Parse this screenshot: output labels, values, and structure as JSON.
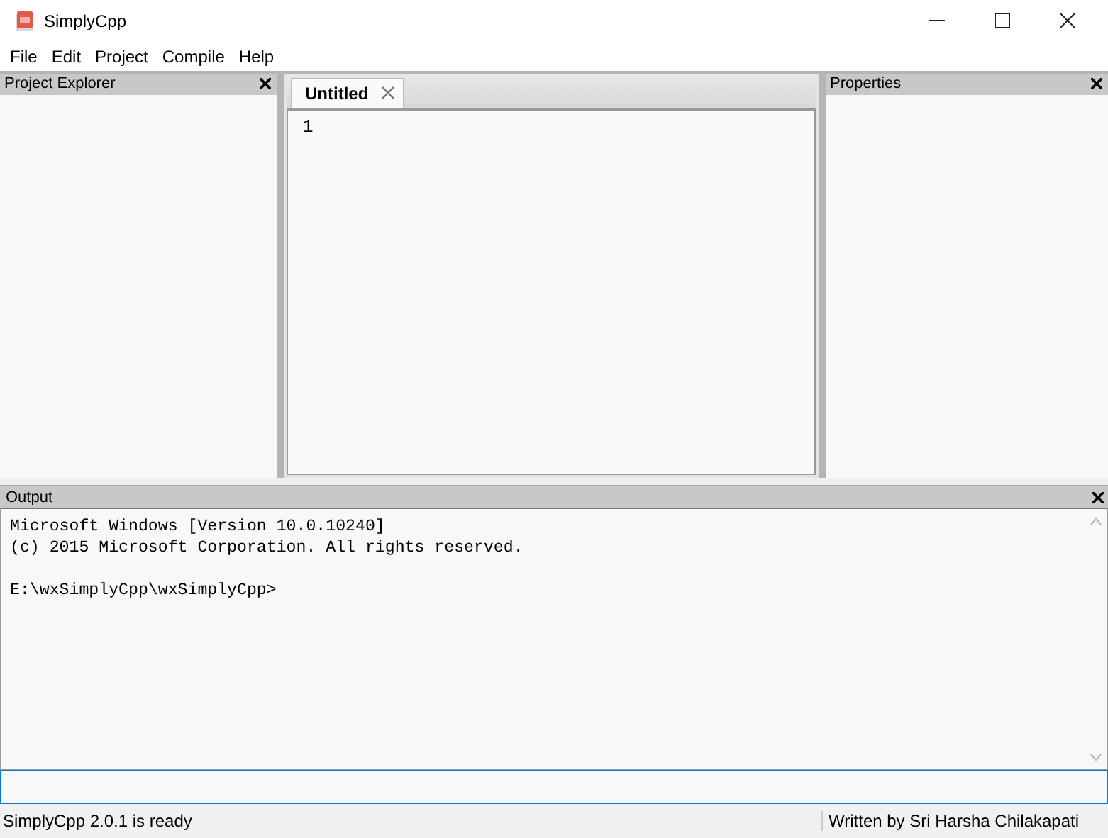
{
  "window": {
    "title": "SimplyCpp"
  },
  "menu": [
    "File",
    "Edit",
    "Project",
    "Compile",
    "Help"
  ],
  "project_explorer": {
    "title": "Project Explorer"
  },
  "editor": {
    "tabs": [
      {
        "label": "Untitled",
        "selected": true
      }
    ],
    "line_numbers": [
      "1"
    ]
  },
  "properties": {
    "title": "Properties"
  },
  "output": {
    "title": "Output",
    "lines": [
      "Microsoft Windows [Version 10.0.10240]",
      "(c) 2015 Microsoft Corporation. All rights reserved."
    ],
    "prompt": "E:\\wxSimplyCpp\\wxSimplyCpp>"
  },
  "status_bar": [
    "SimplyCpp 2.0.1 is ready",
    "Written by Sri Harsha Chilakapati"
  ]
}
